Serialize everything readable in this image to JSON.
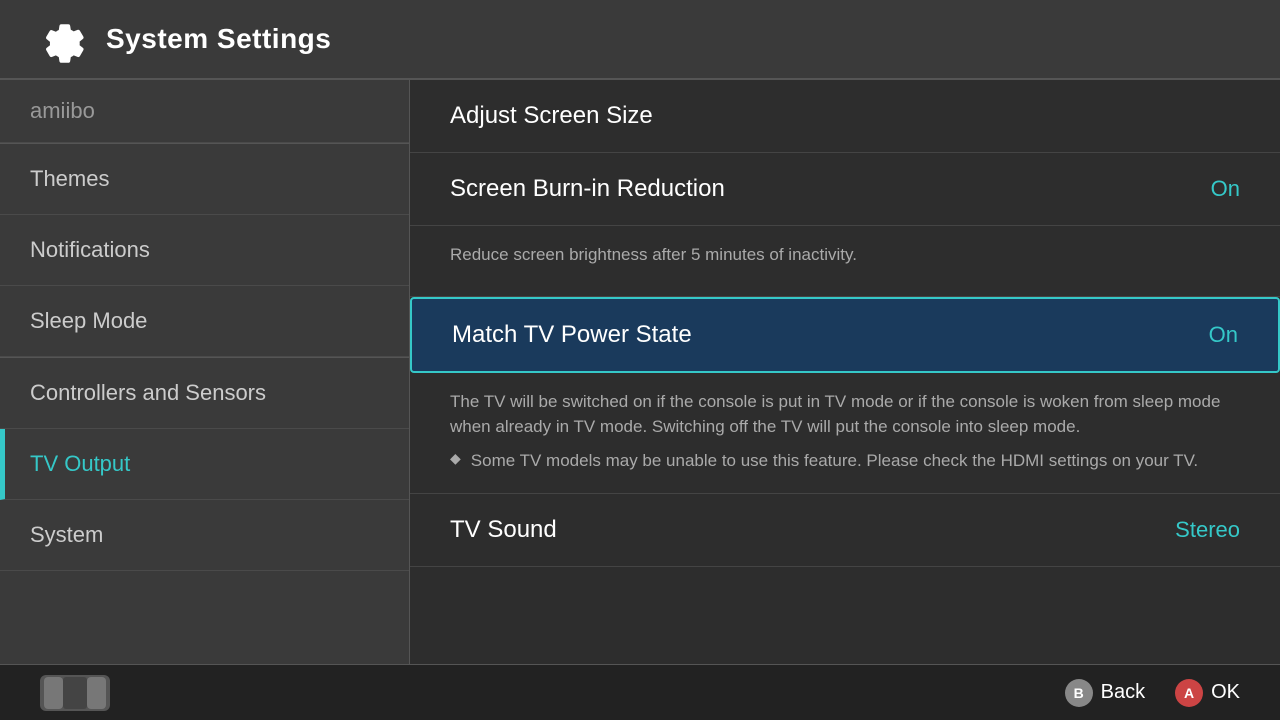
{
  "header": {
    "title": "System Settings",
    "icon": "gear"
  },
  "sidebar": {
    "amiibo_label": "amiibo",
    "items": [
      {
        "id": "themes",
        "label": "Themes",
        "active": false
      },
      {
        "id": "notifications",
        "label": "Notifications",
        "active": false
      },
      {
        "id": "sleep-mode",
        "label": "Sleep Mode",
        "active": false
      },
      {
        "id": "controllers-sensors",
        "label": "Controllers and Sensors",
        "active": false
      },
      {
        "id": "tv-output",
        "label": "TV Output",
        "active": true
      },
      {
        "id": "system",
        "label": "System",
        "active": false
      }
    ]
  },
  "content": {
    "items": [
      {
        "id": "adjust-screen-size",
        "title": "Adjust Screen Size",
        "value": "",
        "selected": false,
        "description": null
      },
      {
        "id": "screen-burn-in",
        "title": "Screen Burn-in Reduction",
        "value": "On",
        "selected": false,
        "description": "Reduce screen brightness after 5 minutes of inactivity.",
        "has_desc": true,
        "has_bullet": false
      },
      {
        "id": "match-tv-power",
        "title": "Match TV Power State",
        "value": "On",
        "selected": true,
        "description": "The TV will be switched on if the console is put in TV mode or if the console is woken from sleep mode when already in TV mode. Switching off the TV will put the console into sleep mode.",
        "has_desc": true,
        "has_bullet": true,
        "bullet_text": "Some TV models may be unable to use this feature. Please check the HDMI settings on your TV."
      },
      {
        "id": "tv-sound",
        "title": "TV Sound",
        "value": "Stereo",
        "selected": false,
        "description": null
      }
    ]
  },
  "footer": {
    "back_label": "Back",
    "ok_label": "OK",
    "b_button": "B",
    "a_button": "A"
  }
}
